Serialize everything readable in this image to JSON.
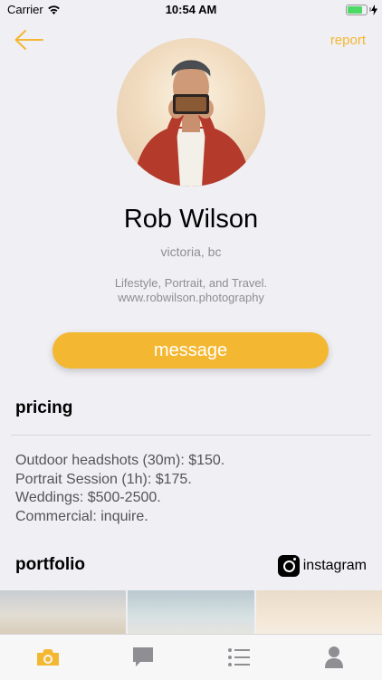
{
  "status_bar": {
    "carrier": "Carrier",
    "time": "10:54 AM",
    "battery_level": 0.8,
    "battery_color": "#4cd964"
  },
  "nav": {
    "back_icon": "arrow-left-icon",
    "report_label": "report"
  },
  "profile": {
    "avatar_icon": "profile-photo",
    "name": "Rob Wilson",
    "location": "victoria, bc",
    "bio_line1": "Lifestyle, Portrait, and Travel.",
    "bio_line2": "www.robwilson.photography",
    "message_label": "message"
  },
  "pricing": {
    "title": "pricing",
    "items": [
      "Outdoor headshots (30m): $150.",
      "Portrait Session (1h): $175.",
      "Weddings: $500-2500.",
      "Commercial: inquire."
    ]
  },
  "portfolio": {
    "title": "portfolio",
    "instagram_label": "instagram",
    "instagram_icon": "instagram-icon",
    "thumbnails": [
      "photo-1",
      "photo-2",
      "photo-3"
    ]
  },
  "tab_bar": {
    "tabs": [
      {
        "icon": "camera-icon",
        "active": true
      },
      {
        "icon": "chat-icon",
        "active": false
      },
      {
        "icon": "list-icon",
        "active": false
      },
      {
        "icon": "person-icon",
        "active": false
      }
    ]
  },
  "colors": {
    "accent": "#f4b731",
    "secondary_text": "#8e8e93",
    "background": "#efeff4",
    "inactive_icon": "#8e8e93"
  }
}
